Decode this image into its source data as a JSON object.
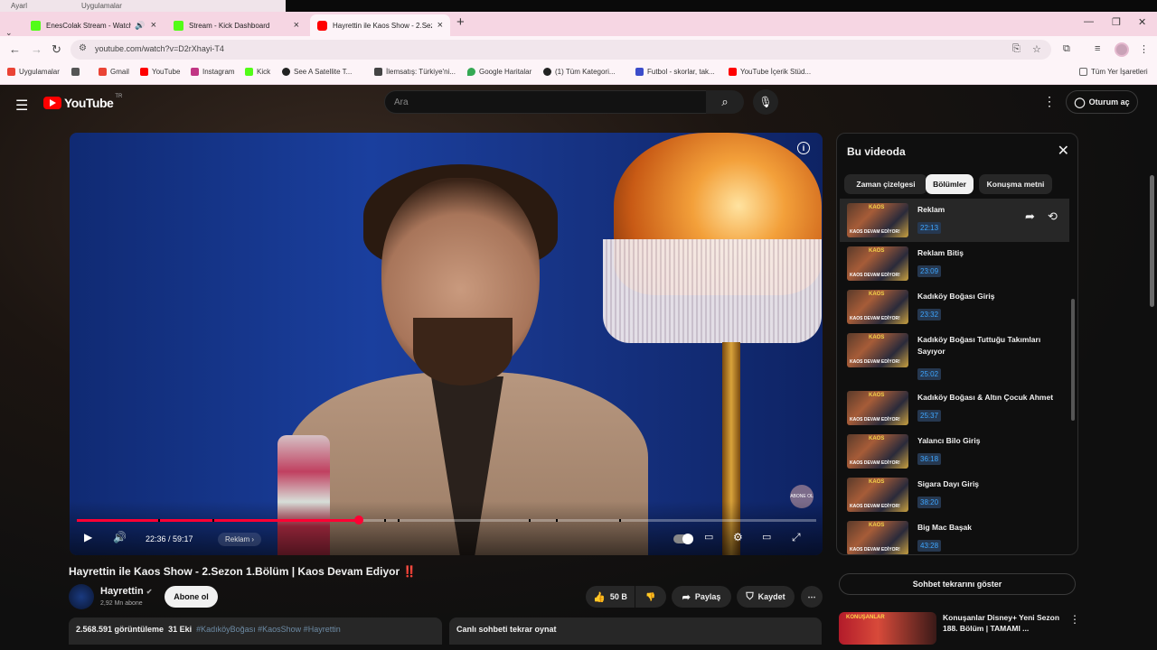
{
  "os": {
    "ghost_left": "Ayarl",
    "ghost_right": "Uygulamalar"
  },
  "tabs": [
    {
      "title": "EnesColak Stream - Watch",
      "color": "#53fc18"
    },
    {
      "title": "Stream - Kick Dashboard",
      "color": "#53fc18"
    },
    {
      "title": "Hayrettin ile Kaos Show - 2.Sez",
      "color": "#ff0000"
    }
  ],
  "window": {
    "minimize": "—",
    "restore": "❐",
    "close": "✕",
    "new_tab": "+"
  },
  "address": {
    "url": "youtube.com/watch?v=D2rXhayi-T4"
  },
  "bookmarks": [
    {
      "label": "Uygulamalar",
      "color": "#ea4335"
    },
    {
      "label": "",
      "color": "#555555"
    },
    {
      "label": "Gmail",
      "color": "#ea4335"
    },
    {
      "label": "YouTube",
      "color": "#ff0000"
    },
    {
      "label": "Instagram",
      "color": "#c13584"
    },
    {
      "label": "Kick",
      "color": "#53fc18"
    },
    {
      "label": "See A Satellite T...",
      "color": "#222222"
    },
    {
      "label": "İlemsatış: Türkiye'ni...",
      "color": "#444444"
    },
    {
      "label": "Google Haritalar",
      "color": "#34a853"
    },
    {
      "label": "(1) Tüm Kategori...",
      "color": "#222222"
    },
    {
      "label": "Futbol - skorlar, tak...",
      "color": "#3b4cca"
    },
    {
      "label": "YouTube İçerik Stüd...",
      "color": "#ff0000"
    },
    {
      "label": "Tüm Yer İşaretleri",
      "color": "#666666"
    }
  ],
  "yt": {
    "logo": "YouTube",
    "region": "TR",
    "search_placeholder": "Ara",
    "signin": "Oturum aç"
  },
  "player": {
    "time": "22:36 / 59:17",
    "chapter": "Reklam",
    "progress": 0.3815,
    "abone": "ABONE OL"
  },
  "video": {
    "title": "Hayrettin ile Kaos Show - 2.Sezon 1.Bölüm | Kaos Devam Ediyor",
    "title_mark": "‼️",
    "channel": "Hayrettin",
    "subs": "2,92 Mn abone",
    "subscribe": "Abone ol",
    "likes": "50 B",
    "share": "Paylaş",
    "save": "Kaydet",
    "views": "2.568.591 görüntüleme",
    "date": "31 Eki",
    "tags": "#KadıköyBoğası #KaosShow #Hayrettin",
    "chat_replay_box": "Canlı sohbeti tekrar oynat"
  },
  "panel": {
    "title": "Bu videoda",
    "chips": [
      "Zaman çizelgesi",
      "Bölümler",
      "Konuşma metni"
    ],
    "thumb_text": "KAOS DEVAM EDİYOR!",
    "thumb_logo": "KAOS",
    "chapters": [
      {
        "name": "Reklam",
        "time": "22:13"
      },
      {
        "name": "Reklam Bitiş",
        "time": "23:09"
      },
      {
        "name": "Kadıköy Boğası Giriş",
        "time": "23:32"
      },
      {
        "name": "Kadıköy Boğası Tuttuğu Takımları Sayıyor",
        "time": "25:02"
      },
      {
        "name": "Kadıköy Boğası & Altın Çocuk Ahmet",
        "time": "25:37"
      },
      {
        "name": "Yalancı Bilo Giriş",
        "time": "36:18"
      },
      {
        "name": "Sigara Dayı Giriş",
        "time": "38:20"
      },
      {
        "name": "Big Mac Başak",
        "time": "43:28"
      }
    ]
  },
  "sidebar": {
    "chat_button": "Sohbet tekrarını göster",
    "rec_title": "Konuşanlar Disney+ Yeni Sezon 188. Bölüm | TAMAMI ...",
    "rec_thumb_text": "KONUŞANLAR"
  }
}
